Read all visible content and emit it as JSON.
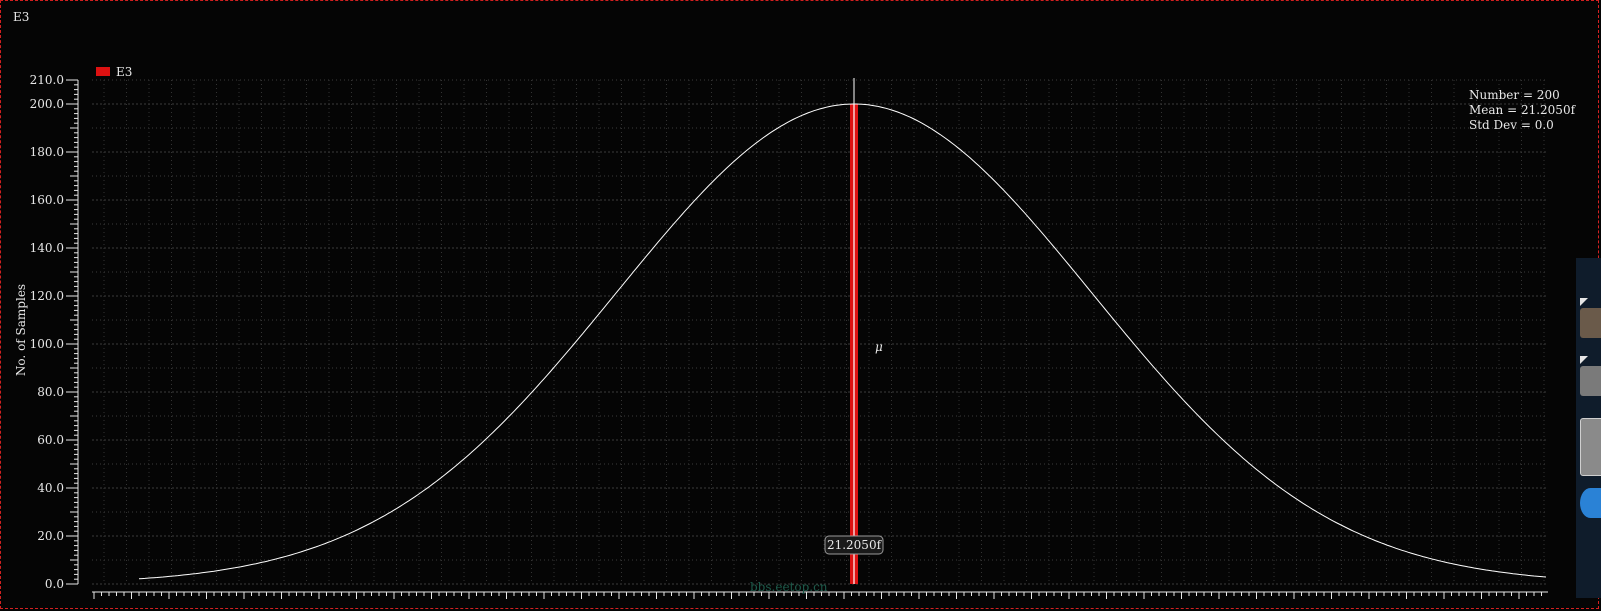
{
  "window": {
    "title": "E3"
  },
  "chart_data": {
    "type": "line",
    "title": "",
    "xlabel": "",
    "ylabel": "No. of Samples",
    "ylim": [
      0,
      210
    ],
    "yticks": [
      "0.0",
      "20.0",
      "40.0",
      "60.0",
      "80.0",
      "100.0",
      "120.0",
      "140.0",
      "160.0",
      "180.0",
      "200.0",
      "210.0"
    ],
    "ytick_values": [
      0,
      20,
      40,
      60,
      80,
      100,
      120,
      140,
      160,
      180,
      200,
      210
    ],
    "grid": true,
    "legend": {
      "placement": "top-left",
      "entries": [
        {
          "label": "E3",
          "color": "#dd1111"
        }
      ]
    },
    "series": [
      {
        "name": "E3",
        "kind": "histogram-bar",
        "value": 200,
        "mean_label": "21.2050f",
        "color": "#dd1111"
      },
      {
        "kind": "normal-fit-curve",
        "color": "#ffffff",
        "x_offset_in_bin_widths": [
          -1.0,
          1.0
        ],
        "peak": 200,
        "edge_value": 2.5
      }
    ],
    "markers": {
      "mean_symbol": "μ"
    },
    "stats": [
      "Number = 200",
      "Mean = 21.2050f",
      "Std Dev = 0.0"
    ]
  },
  "watermark": "bbs.eetop.cn",
  "colors": {
    "background": "#050505",
    "grid": "#3a3a3a",
    "bar": "#dd1111",
    "curve": "#ffffff",
    "frame": "#d42020"
  }
}
